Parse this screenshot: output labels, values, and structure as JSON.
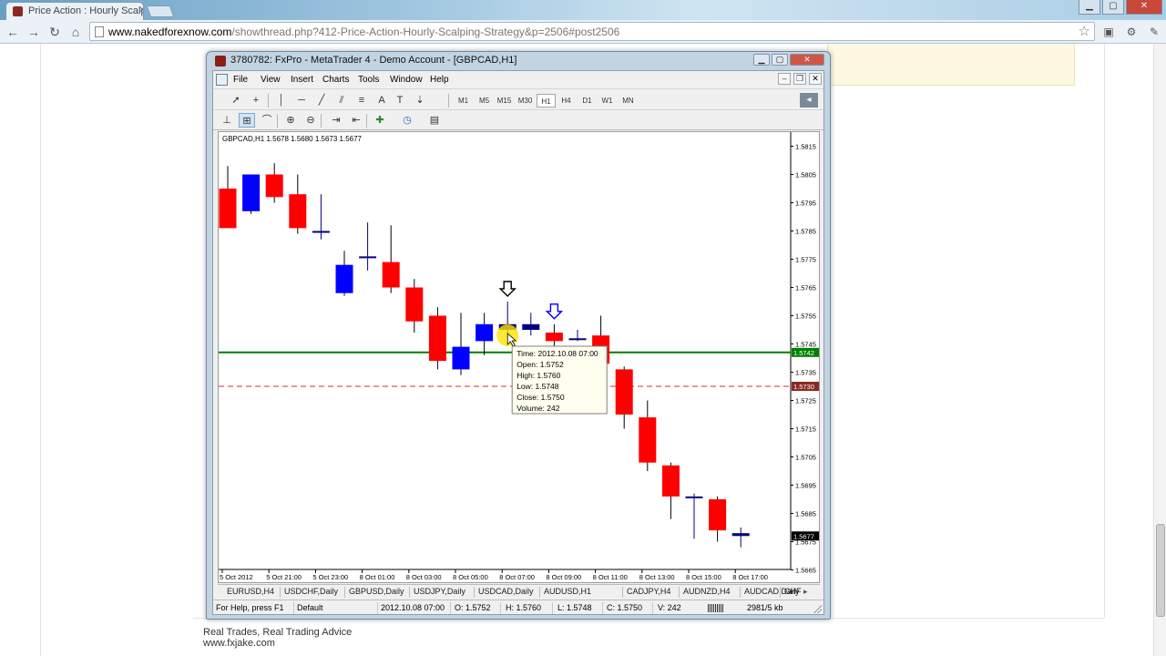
{
  "browser": {
    "tab_title": "Price Action : Hourly Scalp",
    "tab_close": "×",
    "url_host": "www.nakedforexnow.com",
    "url_path": "/showthread.php?412-Price-Action-Hourly-Scalping-Strategy&p=2506#post2506",
    "icons": [
      "back-icon",
      "forward-icon",
      "reload-icon",
      "home-icon",
      "star-icon",
      "extension-icon",
      "wrench-icon"
    ]
  },
  "page": {
    "signature_line1": "Real Trades, Real Trading Advice",
    "signature_line2": "www.fxjake.com"
  },
  "mt4": {
    "title": "3780782: FxPro - MetaTrader 4 - Demo Account - [GBPCAD,H1]",
    "menu": [
      "File",
      "View",
      "Insert",
      "Charts",
      "Tools",
      "Window",
      "Help"
    ],
    "timeframes": [
      "M1",
      "M5",
      "M15",
      "M30",
      "H1",
      "H4",
      "D1",
      "W1",
      "MN"
    ],
    "active_timeframe": "H1",
    "chart_caption": "GBPCAD,H1  1.5678 1.5680 1.5673 1.5677",
    "symbol_tabs": [
      "EURUSD,H4",
      "USDCHF,Daily",
      "GBPUSD,Daily",
      "USDJPY,Daily",
      "USDCAD,Daily",
      "AUDUSD,H1",
      "CADJPY,H4",
      "AUDNZD,H4",
      "AUDCAD,Daily",
      "CHF"
    ],
    "status": {
      "help": "For Help, press F1",
      "profile": "Default",
      "datetime": "2012.10.08 07:00",
      "open": "O: 1.5752",
      "high": "H: 1.5760",
      "low": "L: 1.5748",
      "close": "C: 1.5750",
      "volume": "V: 242",
      "traffic": "2981/5 kb"
    },
    "tooltip": {
      "time": "Time: 2012.10.08 07:00",
      "open": "Open: 1.5752",
      "high": "High: 1.5760",
      "low": "Low: 1.5748",
      "close": "Close: 1.5750",
      "volume": "Volume: 242"
    },
    "colors": {
      "bull": "#0000ff",
      "bear": "#ff0000",
      "doji": "#000080",
      "support_line": "#008000",
      "current_line": "#cc3333",
      "tooltip_marker": "#ffe400"
    }
  },
  "chart_data": {
    "type": "candlestick",
    "symbol": "GBPCAD",
    "timeframe": "H1",
    "ylim": [
      1.566,
      1.582
    ],
    "y_ticks": [
      "1.5815",
      "1.5805",
      "1.5795",
      "1.5785",
      "1.5775",
      "1.5765",
      "1.5755",
      "1.5745",
      "1.5735",
      "1.5725",
      "1.5715",
      "1.5705",
      "1.5695",
      "1.5685",
      "1.5675",
      "1.5665"
    ],
    "x_ticks": [
      "5 Oct 2012",
      "5 Oct 21:00",
      "5 Oct 23:00",
      "8 Oct 01:00",
      "8 Oct 03:00",
      "8 Oct 05:00",
      "8 Oct 07:00",
      "8 Oct 09:00",
      "8 Oct 11:00",
      "8 Oct 13:00",
      "8 Oct 15:00",
      "8 Oct 17:00"
    ],
    "candles": [
      {
        "o": 1.58,
        "h": 1.5808,
        "l": 1.5787,
        "c": 1.5786
      },
      {
        "o": 1.5792,
        "h": 1.5805,
        "l": 1.5791,
        "c": 1.5805
      },
      {
        "o": 1.5805,
        "h": 1.5809,
        "l": 1.5795,
        "c": 1.5797
      },
      {
        "o": 1.5798,
        "h": 1.5805,
        "l": 1.5784,
        "c": 1.5786
      },
      {
        "o": 1.5785,
        "h": 1.5798,
        "l": 1.5782,
        "c": 1.5785
      },
      {
        "o": 1.5763,
        "h": 1.5778,
        "l": 1.5762,
        "c": 1.5773
      },
      {
        "o": 1.5776,
        "h": 1.5788,
        "l": 1.5771,
        "c": 1.5776
      },
      {
        "o": 1.5774,
        "h": 1.5787,
        "l": 1.5763,
        "c": 1.5765
      },
      {
        "o": 1.5765,
        "h": 1.5768,
        "l": 1.5749,
        "c": 1.5753
      },
      {
        "o": 1.5755,
        "h": 1.5758,
        "l": 1.5736,
        "c": 1.5739
      },
      {
        "o": 1.5736,
        "h": 1.5756,
        "l": 1.5734,
        "c": 1.5744
      },
      {
        "o": 1.5746,
        "h": 1.5756,
        "l": 1.5741,
        "c": 1.5752
      },
      {
        "o": 1.5752,
        "h": 1.576,
        "l": 1.5748,
        "c": 1.575
      },
      {
        "o": 1.5752,
        "h": 1.5756,
        "l": 1.5748,
        "c": 1.575
      },
      {
        "o": 1.5749,
        "h": 1.5752,
        "l": 1.5744,
        "c": 1.5746
      },
      {
        "o": 1.5747,
        "h": 1.575,
        "l": 1.5746,
        "c": 1.5747
      },
      {
        "o": 1.5748,
        "h": 1.5755,
        "l": 1.5733,
        "c": 1.5738
      },
      {
        "o": 1.5736,
        "h": 1.5737,
        "l": 1.5715,
        "c": 1.572
      },
      {
        "o": 1.5719,
        "h": 1.5725,
        "l": 1.57,
        "c": 1.5703
      },
      {
        "o": 1.5702,
        "h": 1.5703,
        "l": 1.5683,
        "c": 1.5691
      },
      {
        "o": 1.5691,
        "h": 1.5692,
        "l": 1.5676,
        "c": 1.5691
      },
      {
        "o": 1.569,
        "h": 1.5691,
        "l": 1.5675,
        "c": 1.5679
      },
      {
        "o": 1.5678,
        "h": 1.568,
        "l": 1.5673,
        "c": 1.5677
      }
    ],
    "support_level": 1.5742,
    "support_label": "1.5742",
    "current_level": 1.573,
    "current_label": "1.5730",
    "last_price_label": "1.5677",
    "arrows": [
      {
        "candle": 12,
        "color": "#000000"
      },
      {
        "candle": 14,
        "color": "#0000ff"
      }
    ]
  }
}
